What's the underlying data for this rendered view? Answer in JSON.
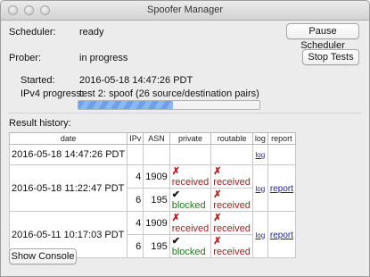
{
  "window": {
    "title": "Spoofer Manager"
  },
  "scheduler": {
    "label": "Scheduler:",
    "status": "ready",
    "button": "Pause Scheduler"
  },
  "prober": {
    "label": "Prober:",
    "status": "in progress",
    "button": "Stop Tests"
  },
  "started": {
    "label": "Started:",
    "value": "2016-05-18 14:47:26 PDT"
  },
  "ipv4": {
    "label": "IPv4 progress:",
    "value": "test 2:  spoof (26 source/destination pairs)",
    "progress": 0.52
  },
  "history": {
    "label": "Result history:",
    "columns": [
      "date",
      "IPv",
      "ASN",
      "private",
      "routable",
      "log",
      "report"
    ],
    "rows": [
      {
        "date": "2016-05-18 14:47:26 PDT",
        "log": "log"
      },
      {
        "date": "2016-05-18 11:22:47 PDT",
        "log": "log",
        "report": "report",
        "sub": [
          {
            "ipv": "4",
            "asn": "1909",
            "private": "received",
            "routable": "received"
          },
          {
            "ipv": "6",
            "asn": "195",
            "private": "blocked",
            "routable": "received"
          }
        ]
      },
      {
        "date": "2016-05-11 10:17:03 PDT",
        "log": "log",
        "report": "report",
        "sub": [
          {
            "ipv": "4",
            "asn": "1909",
            "private": "received",
            "routable": "received"
          },
          {
            "ipv": "6",
            "asn": "195",
            "private": "blocked",
            "routable": "received"
          }
        ]
      }
    ]
  },
  "console_button": "Show Console",
  "symbols": {
    "cross": "✗",
    "check": "✔"
  },
  "colors": {
    "received": "#b31b1b",
    "blocked": "#1f7a1f",
    "link": "#1a1aa6"
  }
}
